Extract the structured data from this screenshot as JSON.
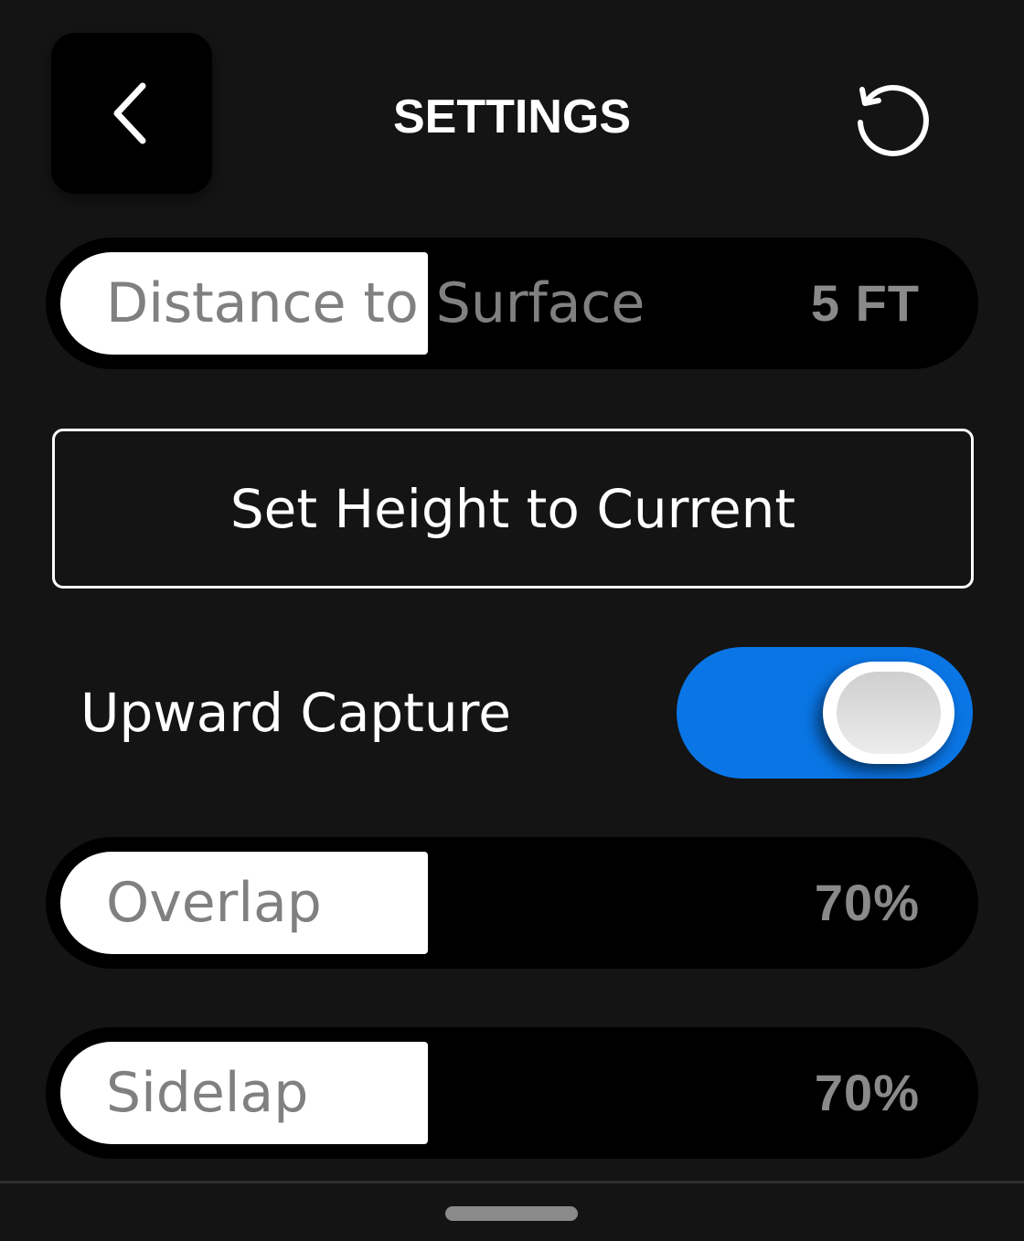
{
  "header": {
    "title": "SETTINGS",
    "back_icon": "chevron-left-icon",
    "reset_icon": "refresh-icon"
  },
  "distance_slider": {
    "label": "Distance to Surface",
    "value": "5 FT",
    "fill_fraction": 0.4
  },
  "set_height_button": {
    "label": "Set Height to Current"
  },
  "upward_capture": {
    "label": "Upward Capture",
    "enabled": true,
    "on_color": "#0a76e6"
  },
  "overlap_slider": {
    "label": "Overlap",
    "value": "70%",
    "fill_fraction": 0.4
  },
  "sidelap_slider": {
    "label": "Sidelap",
    "value": "70%",
    "fill_fraction": 0.4
  }
}
